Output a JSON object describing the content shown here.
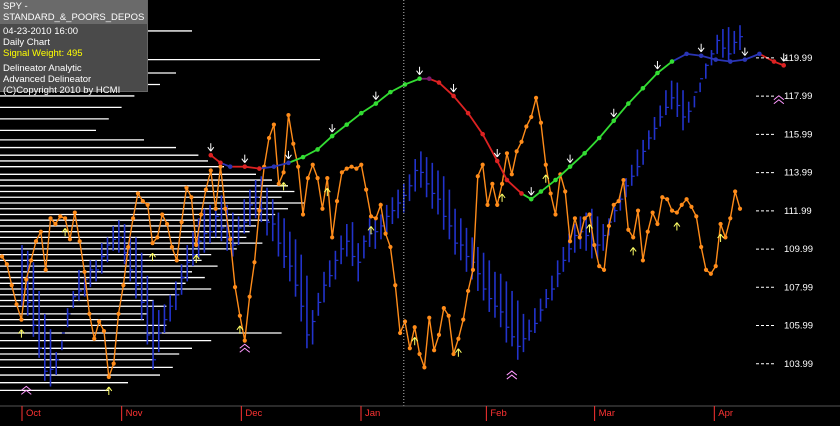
{
  "info": {
    "title": "SPY - STANDARD_&_POORS_DEPOS",
    "datetime": "04-23-2010  16:00",
    "period": "Daily Chart",
    "signal_weight": "Signal Weight: 495",
    "line1": "Delineator Analytic",
    "line2": "Advanced Delineator",
    "copyright": "(C)Copyright 2010 by HCMI"
  },
  "colors": {
    "background": "#000000",
    "price_bars": "#2233cc",
    "oscillator": "#ff8c1a",
    "trend_up": "#33dd33",
    "trend_down": "#dd2222",
    "trend_neutral": "#2a35b5",
    "month_labels": "#ff3333",
    "axis_labels": "#ffffff",
    "volume_profile": "#ffffff"
  },
  "chart_data": {
    "type": "line",
    "symbol": "SPY",
    "y_ticks": [
      "119.99",
      "117.99",
      "115.99",
      "113.99",
      "111.99",
      "109.99",
      "107.99",
      "105.99",
      "103.99"
    ],
    "ylim": [
      102.2,
      122.6
    ],
    "x_months": [
      "Oct",
      "Nov",
      "Dec",
      "Jan",
      "Feb",
      "Mar",
      "Apr"
    ],
    "year_divider_index": 67,
    "bars": {
      "high": [
        110.2,
        109.9,
        109.3,
        107.8,
        106.6,
        105.8,
        104.6,
        105.2,
        106.9,
        107.8,
        108.9,
        108.9,
        109.4,
        109.4,
        110.3,
        110.6,
        111.2,
        111.5,
        111.3,
        110.7,
        110.6,
        109.8,
        108.6,
        107.3,
        106.8,
        107.1,
        107.6,
        108.3,
        109.2,
        110.2,
        110.9,
        111.6,
        112.1,
        112.3,
        112.5,
        112.8,
        112.3,
        111.9,
        111.7,
        112.6,
        113.1,
        113.6,
        113.8,
        113.2,
        112.6,
        111.9,
        111.6,
        110.9,
        110.5,
        109.7,
        108.6,
        106.8,
        107.7,
        108.8,
        109.4,
        109.9,
        110.7,
        111.3,
        111.4,
        110.3,
        110.7,
        111.6,
        111.6,
        111.8,
        112.3,
        112.7,
        113.1,
        113.4,
        113.9,
        114.7,
        115.1,
        114.8,
        114.5,
        114.1,
        113.8,
        113.1,
        112.1,
        111.6,
        111.1,
        110.6,
        110.1,
        109.8,
        109.4,
        108.8,
        108.7,
        108.3,
        107.8,
        107.3,
        106.6,
        106.3,
        106.9,
        107.4,
        107.9,
        108.6,
        109.4,
        110.1,
        110.8,
        111.3,
        111.7,
        111.9,
        112.1,
        111.7,
        111.3,
        111.6,
        112.2,
        112.9,
        113.7,
        114.4,
        115.2,
        115.7,
        116.2,
        116.9,
        117.5,
        118.3,
        118.8,
        118.7,
        118.3,
        117.7,
        118.0,
        118.7,
        119.7,
        120.4,
        121.2,
        121.5,
        121.6,
        121.4,
        121.7
      ],
      "low": [
        107.0,
        106.5,
        105.4,
        104.3,
        103.1,
        102.8,
        103.4,
        104.7,
        105.9,
        106.9,
        107.3,
        107.5,
        108.0,
        108.3,
        108.7,
        109.3,
        109.9,
        109.8,
        109.2,
        108.3,
        107.4,
        106.3,
        105.0,
        103.7,
        104.6,
        105.6,
        106.2,
        106.8,
        107.6,
        108.3,
        109.1,
        109.5,
        109.8,
        110.3,
        110.6,
        110.4,
        109.9,
        109.6,
        110.2,
        110.8,
        111.2,
        111.6,
        111.4,
        110.7,
        110.4,
        109.6,
        109.0,
        108.3,
        107.5,
        106.2,
        104.8,
        105.0,
        106.5,
        107.2,
        108.0,
        108.4,
        109.2,
        109.6,
        109.1,
        108.3,
        109.5,
        110.1,
        110.0,
        110.5,
        110.8,
        111.3,
        111.6,
        111.9,
        112.5,
        113.0,
        113.2,
        112.7,
        112.1,
        111.8,
        111.0,
        110.5,
        109.7,
        109.4,
        108.8,
        108.4,
        107.8,
        107.3,
        106.7,
        106.4,
        105.9,
        105.1,
        104.9,
        104.2,
        104.6,
        105.2,
        105.6,
        106.2,
        106.9,
        107.3,
        108.0,
        108.8,
        109.3,
        109.8,
        110.0,
        109.9,
        109.5,
        109.5,
        109.9,
        110.7,
        111.4,
        112.0,
        112.7,
        113.3,
        113.8,
        114.4,
        115.2,
        115.7,
        116.4,
        117.0,
        117.3,
        116.9,
        116.2,
        116.6,
        117.4,
        118.2,
        118.9,
        119.6,
        120.2,
        120.0,
        119.8,
        120.2,
        120.4
      ],
      "close": [
        107.9,
        107.2,
        106.0,
        104.8,
        103.6,
        103.7,
        104.2,
        105.6,
        106.6,
        107.5,
        107.8,
        108.4,
        108.9,
        108.9,
        109.6,
        110.2,
        110.5,
        110.6,
        109.8,
        108.9,
        108.1,
        107.2,
        105.5,
        104.2,
        105.6,
        106.3,
        107.0,
        107.6,
        108.5,
        109.3,
        109.7,
        110.4,
        110.8,
        110.9,
        111.7,
        111.1,
        110.6,
        110.2,
        111.1,
        111.4,
        112.3,
        112.7,
        112.1,
        111.4,
        111.3,
        110.3,
        109.6,
        109.1,
        108.1,
        107.0,
        105.5,
        106.2,
        107.2,
        108.1,
        108.6,
        109.4,
        110.0,
        110.4,
        109.6,
        109.3,
        110.4,
        110.8,
        110.9,
        111.2,
        111.7,
        112.0,
        112.4,
        112.8,
        113.3,
        114.1,
        114.0,
        113.4,
        112.9,
        112.6,
        111.7,
        111.2,
        110.3,
        110.2,
        109.6,
        109.3,
        108.7,
        107.9,
        107.4,
        107.0,
        106.7,
        105.9,
        105.4,
        104.9,
        105.3,
        105.7,
        106.1,
        106.8,
        107.4,
        107.9,
        108.7,
        109.4,
        110.0,
        110.7,
        110.9,
        110.7,
        110.2,
        110.2,
        110.7,
        111.4,
        112.0,
        112.6,
        113.3,
        113.8,
        114.3,
        115.1,
        115.8,
        116.3,
        116.9,
        117.4,
        117.9,
        117.5,
        116.9,
        117.2,
        118.2,
        118.9,
        119.6,
        120.2,
        120.9,
        120.5,
        120.2,
        120.8,
        121.1
      ]
    },
    "oscillator": [
      109.6,
      109.2,
      108.1,
      107.1,
      106.3,
      108.4,
      109.4,
      110.4,
      110.9,
      108.9,
      111.6,
      111.3,
      111.7,
      111.6,
      110.5,
      111.9,
      110.4,
      108.8,
      106.6,
      105.3,
      106.2,
      105.7,
      103.3,
      104.0,
      106.6,
      108.1,
      110.1,
      111.6,
      112.9,
      112.5,
      112.3,
      110.3,
      110.6,
      111.8,
      111.3,
      110.1,
      109.4,
      111.4,
      113.2,
      112.7,
      110.2,
      111.8,
      113.1,
      114.1,
      112.1,
      114.3,
      112.1,
      110.5,
      108.0,
      106.5,
      105.2,
      107.5,
      109.3,
      112.0,
      114.3,
      115.8,
      116.5,
      113.4,
      114.0,
      117.0,
      115.5,
      114.3,
      111.8,
      113.7,
      114.4,
      113.7,
      112.1,
      113.7,
      110.6,
      112.5,
      114.0,
      114.2,
      114.3,
      114.2,
      114.4,
      113.1,
      111.7,
      111.6,
      112.3,
      110.8,
      110.1,
      108.1,
      105.6,
      106.2,
      104.8,
      105.9,
      104.5,
      103.8,
      106.4,
      104.7,
      105.5,
      106.9,
      106.5,
      104.5,
      105.3,
      106.3,
      107.8,
      108.9,
      113.8,
      114.4,
      112.3,
      113.4,
      112.3,
      113.4,
      115.0,
      113.9,
      115.1,
      115.6,
      116.4,
      116.9,
      117.9,
      116.6,
      114.4,
      112.9,
      111.8,
      113.9,
      113.0,
      110.4,
      111.6,
      110.6,
      111.6,
      111.8,
      110.2,
      109.1,
      108.9,
      111.2,
      112.3,
      112.5,
      113.6,
      111.0,
      110.6,
      112.0,
      109.4,
      110.9,
      111.9,
      111.3,
      112.7,
      112.6,
      112.0,
      111.9,
      112.3,
      112.6,
      112.2,
      111.7,
      110.1,
      108.9,
      108.7,
      109.1,
      111.3,
      110.6,
      111.6,
      113.0,
      112.1
    ],
    "trend_line": [
      {
        "i": 43,
        "v": 114.9,
        "state": "down"
      },
      {
        "i": 45,
        "v": 114.5,
        "state": "down"
      },
      {
        "i": 47,
        "v": 114.3,
        "state": "neutral"
      },
      {
        "i": 50,
        "v": 114.3,
        "state": "down"
      },
      {
        "i": 53,
        "v": 114.2,
        "state": "down"
      },
      {
        "i": 56,
        "v": 114.3,
        "state": "neutral"
      },
      {
        "i": 59,
        "v": 114.5,
        "state": "neutral"
      },
      {
        "i": 62,
        "v": 114.8,
        "state": "up"
      },
      {
        "i": 65,
        "v": 115.2,
        "state": "up"
      },
      {
        "i": 68,
        "v": 115.9,
        "state": "up"
      },
      {
        "i": 71,
        "v": 116.5,
        "state": "up"
      },
      {
        "i": 74,
        "v": 117.1,
        "state": "up"
      },
      {
        "i": 77,
        "v": 117.6,
        "state": "up"
      },
      {
        "i": 80,
        "v": 118.2,
        "state": "up"
      },
      {
        "i": 83,
        "v": 118.6,
        "state": "up"
      },
      {
        "i": 86,
        "v": 118.9,
        "state": "up"
      },
      {
        "i": 88,
        "v": 118.9,
        "state": "mixed"
      },
      {
        "i": 90,
        "v": 118.7,
        "state": "down"
      },
      {
        "i": 93,
        "v": 118.0,
        "state": "down"
      },
      {
        "i": 96,
        "v": 117.1,
        "state": "down"
      },
      {
        "i": 99,
        "v": 116.0,
        "state": "down"
      },
      {
        "i": 102,
        "v": 114.6,
        "state": "down"
      },
      {
        "i": 104,
        "v": 113.6,
        "state": "down"
      },
      {
        "i": 107,
        "v": 112.9,
        "state": "down"
      },
      {
        "i": 109,
        "v": 112.6,
        "state": "up"
      },
      {
        "i": 111,
        "v": 113.0,
        "state": "up"
      },
      {
        "i": 114,
        "v": 113.6,
        "state": "up"
      },
      {
        "i": 117,
        "v": 114.3,
        "state": "up"
      },
      {
        "i": 120,
        "v": 115.0,
        "state": "up"
      },
      {
        "i": 123,
        "v": 115.8,
        "state": "up"
      },
      {
        "i": 126,
        "v": 116.7,
        "state": "up"
      },
      {
        "i": 129,
        "v": 117.6,
        "state": "up"
      },
      {
        "i": 132,
        "v": 118.4,
        "state": "up"
      },
      {
        "i": 135,
        "v": 119.2,
        "state": "up"
      },
      {
        "i": 138,
        "v": 119.8,
        "state": "up"
      },
      {
        "i": 141,
        "v": 120.2,
        "state": "neutral"
      },
      {
        "i": 144,
        "v": 120.1,
        "state": "neutral"
      },
      {
        "i": 147,
        "v": 119.9,
        "state": "neutral"
      },
      {
        "i": 150,
        "v": 119.8,
        "state": "neutral"
      },
      {
        "i": 153,
        "v": 119.9,
        "state": "neutral"
      },
      {
        "i": 156,
        "v": 120.2,
        "state": "neutral"
      },
      {
        "i": 159,
        "v": 119.8,
        "state": "down"
      },
      {
        "i": 161,
        "v": 119.6,
        "state": "down"
      }
    ],
    "volume_profile": [
      {
        "price": 121.4,
        "level": 0.6
      },
      {
        "price": 120.9,
        "level": 0.36
      },
      {
        "price": 120.5,
        "level": 0.3
      },
      {
        "price": 119.9,
        "level": 1.0
      },
      {
        "price": 119.2,
        "level": 0.55
      },
      {
        "price": 118.6,
        "level": 0.5
      },
      {
        "price": 118.0,
        "level": 0.42
      },
      {
        "price": 117.4,
        "level": 0.38
      },
      {
        "price": 116.8,
        "level": 0.34
      },
      {
        "price": 116.2,
        "level": 0.3
      },
      {
        "price": 115.7,
        "level": 0.45
      },
      {
        "price": 115.3,
        "level": 0.55
      },
      {
        "price": 114.9,
        "level": 0.62
      },
      {
        "price": 114.6,
        "level": 0.65
      },
      {
        "price": 114.3,
        "level": 0.7
      },
      {
        "price": 113.9,
        "level": 0.8
      },
      {
        "price": 113.6,
        "level": 0.85
      },
      {
        "price": 113.3,
        "level": 0.9
      },
      {
        "price": 113.0,
        "level": 0.92
      },
      {
        "price": 112.7,
        "level": 0.88
      },
      {
        "price": 112.4,
        "level": 0.95
      },
      {
        "price": 112.1,
        "level": 0.9
      },
      {
        "price": 111.8,
        "level": 0.86
      },
      {
        "price": 111.5,
        "level": 0.84
      },
      {
        "price": 111.2,
        "level": 0.8
      },
      {
        "price": 110.9,
        "level": 0.78
      },
      {
        "price": 110.6,
        "level": 0.77
      },
      {
        "price": 110.3,
        "level": 0.82
      },
      {
        "price": 110.0,
        "level": 0.74
      },
      {
        "price": 109.7,
        "level": 0.66
      },
      {
        "price": 109.4,
        "level": 0.63
      },
      {
        "price": 109.1,
        "level": 0.68
      },
      {
        "price": 108.8,
        "level": 0.6
      },
      {
        "price": 108.5,
        "level": 0.64
      },
      {
        "price": 108.2,
        "level": 0.58
      },
      {
        "price": 107.9,
        "level": 0.66
      },
      {
        "price": 107.6,
        "level": 0.56
      },
      {
        "price": 107.3,
        "level": 0.48
      },
      {
        "price": 107.0,
        "level": 0.52
      },
      {
        "price": 106.6,
        "level": 0.46
      },
      {
        "price": 106.3,
        "level": 0.45
      },
      {
        "price": 106.0,
        "level": 0.52
      },
      {
        "price": 105.6,
        "level": 0.88
      },
      {
        "price": 105.2,
        "level": 0.66
      },
      {
        "price": 104.8,
        "level": 0.6
      },
      {
        "price": 104.5,
        "level": 0.56
      },
      {
        "price": 104.2,
        "level": 0.48
      },
      {
        "price": 103.8,
        "level": 0.54
      },
      {
        "price": 103.4,
        "level": 0.5
      },
      {
        "price": 103.0,
        "level": 0.4
      },
      {
        "price": 102.6,
        "level": 0.34
      }
    ]
  }
}
